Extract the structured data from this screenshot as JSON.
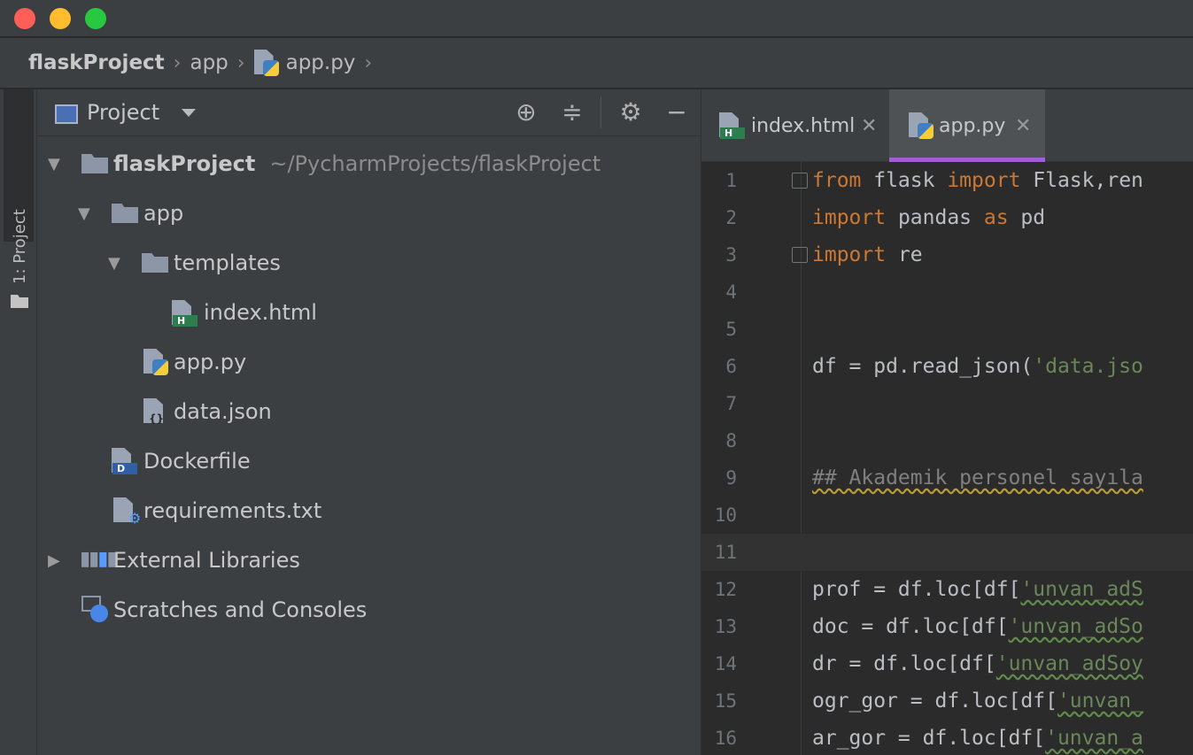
{
  "window": {
    "breadcrumb": [
      {
        "label": "flaskProject"
      },
      {
        "label": "app"
      },
      {
        "label": "app.py"
      }
    ]
  },
  "toolstrip": {
    "project_tab_label": "1: Project"
  },
  "project_panel": {
    "title": "Project",
    "tree": {
      "root_label": "flaskProject",
      "root_path": "~/PycharmProjects/flaskProject",
      "app_label": "app",
      "templates_label": "templates",
      "index_label": "index.html",
      "apppy_label": "app.py",
      "datajson_label": "data.json",
      "dockerfile_label": "Dockerfile",
      "requirements_label": "requirements.txt",
      "external_label": "External Libraries",
      "scratches_label": "Scratches and Consoles"
    }
  },
  "editor": {
    "tabs": [
      {
        "label": "index.html"
      },
      {
        "label": "app.py"
      }
    ],
    "line_numbers": [
      "1",
      "2",
      "3",
      "4",
      "5",
      "6",
      "7",
      "8",
      "9",
      "10",
      "11",
      "12",
      "13",
      "14",
      "15",
      "16"
    ],
    "code": {
      "l1_kw1": "from",
      "l1_mod": " flask ",
      "l1_kw2": "import",
      "l1_rest": " Flask,ren",
      "l2_kw1": "import",
      "l2_mod": " pandas ",
      "l2_kw2": "as",
      "l2_rest": " pd",
      "l3_kw1": "import",
      "l3_rest": " re",
      "l6_pre": "df = pd.read_json(",
      "l6_str": "'data.jso",
      "l9_cmt": "## Akademik personel sayıla",
      "l12_pre": "prof = df.loc[df[",
      "l12_str": "'unvan_adS",
      "l13_pre": "doc = df.loc[df[",
      "l13_str": "'unvan_adSo",
      "l14_pre": "dr = df.loc[df[",
      "l14_str": "'unvan_adSoy",
      "l15_pre": "ogr_gor = df.loc[df[",
      "l15_str": "'unvan_",
      "l16_pre": "ar_gor = df.loc[df[",
      "l16_str": "'unvan_a"
    }
  },
  "colors": {
    "keyword": "#cc7832",
    "string": "#6a8759",
    "comment": "#808080",
    "active_tab_underline": "#9e5ed6"
  },
  "icons": [
    "crosshair-icon",
    "collapse-all-icon",
    "gear-icon",
    "minimize-icon",
    "python-file-icon",
    "html-file-icon",
    "json-file-icon",
    "docker-file-icon",
    "text-file-icon",
    "library-icon",
    "scratch-icon",
    "folder-icon"
  ]
}
